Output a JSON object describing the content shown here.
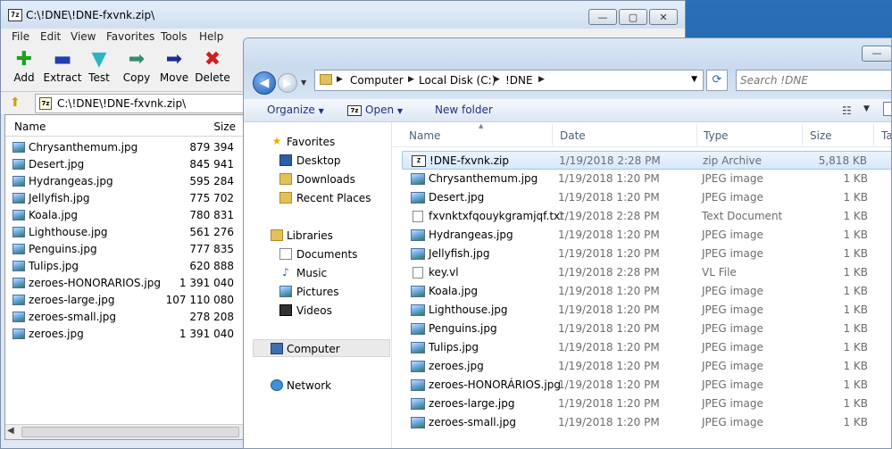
{
  "zip_window": {
    "title": "C:\\!DNE\\!DNE-fxvnk.zip\\",
    "caption": {
      "minimize": "—",
      "maximize": "▢",
      "close": "✕"
    },
    "menu": [
      "File",
      "Edit",
      "View",
      "Favorites",
      "Tools",
      "Help"
    ],
    "toolbar": [
      {
        "label": "Add",
        "icon": "plus-icon",
        "glyph": "✚",
        "color": "#1aa31a"
      },
      {
        "label": "Extract",
        "icon": "minus-icon",
        "glyph": "▬",
        "color": "#1f3fb0"
      },
      {
        "label": "Test",
        "icon": "check-icon",
        "glyph": "▼",
        "color": "#2bb3c4"
      },
      {
        "label": "Copy",
        "icon": "copy-arrow-icon",
        "glyph": "➡",
        "color": "#2f8f6a"
      },
      {
        "label": "Move",
        "icon": "move-arrow-icon",
        "glyph": "➡",
        "color": "#1b2f93"
      },
      {
        "label": "Delete",
        "icon": "delete-x-icon",
        "glyph": "✖",
        "color": "#d11f1f"
      }
    ],
    "path": "C:\\!DNE\\!DNE-fxvnk.zip\\",
    "columns": {
      "name": "Name",
      "size": "Size"
    },
    "files": [
      {
        "name": "Chrysanthemum.jpg",
        "size": "879 394"
      },
      {
        "name": "Desert.jpg",
        "size": "845 941"
      },
      {
        "name": "Hydrangeas.jpg",
        "size": "595 284"
      },
      {
        "name": "Jellyfish.jpg",
        "size": "775 702"
      },
      {
        "name": "Koala.jpg",
        "size": "780 831"
      },
      {
        "name": "Lighthouse.jpg",
        "size": "561 276"
      },
      {
        "name": "Penguins.jpg",
        "size": "777 835"
      },
      {
        "name": "Tulips.jpg",
        "size": "620 888"
      },
      {
        "name": "zeroes-HONORARIOS.jpg",
        "size": "1 391 040"
      },
      {
        "name": "zeroes-large.jpg",
        "size": "107 110 080"
      },
      {
        "name": "zeroes-small.jpg",
        "size": "278 208"
      },
      {
        "name": "zeroes.jpg",
        "size": "1 391 040"
      }
    ]
  },
  "explorer": {
    "breadcrumb": [
      "Computer",
      "Local Disk (C:)",
      "!DNE"
    ],
    "search_placeholder": "Search !DNE",
    "commands": {
      "organize": "Organize",
      "open": "Open",
      "new_folder": "New folder"
    },
    "open_icon_text": "7z",
    "nav": {
      "favorites": "Favorites",
      "favorites_items": [
        "Desktop",
        "Downloads",
        "Recent Places"
      ],
      "libraries": "Libraries",
      "libraries_items": [
        "Documents",
        "Music",
        "Pictures",
        "Videos"
      ],
      "computer": "Computer",
      "network": "Network"
    },
    "columns": {
      "name": "Name",
      "date": "Date",
      "type": "Type",
      "size": "Size",
      "tags": "Ta"
    },
    "files": [
      {
        "name": "!DNE-fxvnk.zip",
        "date": "1/19/2018 2:28 PM",
        "type": "zip Archive",
        "size": "5,818 KB",
        "kind": "zip",
        "selected": true
      },
      {
        "name": "Chrysanthemum.jpg",
        "date": "1/19/2018 1:20 PM",
        "type": "JPEG image",
        "size": "1 KB",
        "kind": "jpg"
      },
      {
        "name": "Desert.jpg",
        "date": "1/19/2018 1:20 PM",
        "type": "JPEG image",
        "size": "1 KB",
        "kind": "jpg"
      },
      {
        "name": "fxvnktxfqouykgramjqf.txt",
        "date": "1/19/2018 2:28 PM",
        "type": "Text Document",
        "size": "1 KB",
        "kind": "txt"
      },
      {
        "name": "Hydrangeas.jpg",
        "date": "1/19/2018 1:20 PM",
        "type": "JPEG image",
        "size": "1 KB",
        "kind": "jpg"
      },
      {
        "name": "Jellyfish.jpg",
        "date": "1/19/2018 1:20 PM",
        "type": "JPEG image",
        "size": "1 KB",
        "kind": "jpg"
      },
      {
        "name": "key.vl",
        "date": "1/19/2018 2:28 PM",
        "type": "VL File",
        "size": "1 KB",
        "kind": "vl"
      },
      {
        "name": "Koala.jpg",
        "date": "1/19/2018 1:20 PM",
        "type": "JPEG image",
        "size": "1 KB",
        "kind": "jpg"
      },
      {
        "name": "Lighthouse.jpg",
        "date": "1/19/2018 1:20 PM",
        "type": "JPEG image",
        "size": "1 KB",
        "kind": "jpg"
      },
      {
        "name": "Penguins.jpg",
        "date": "1/19/2018 1:20 PM",
        "type": "JPEG image",
        "size": "1 KB",
        "kind": "jpg"
      },
      {
        "name": "Tulips.jpg",
        "date": "1/19/2018 1:20 PM",
        "type": "JPEG image",
        "size": "1 KB",
        "kind": "jpg"
      },
      {
        "name": "zeroes.jpg",
        "date": "1/19/2018 1:20 PM",
        "type": "JPEG image",
        "size": "1 KB",
        "kind": "jpg"
      },
      {
        "name": "zeroes-HONORÁRIOS.jpg",
        "date": "1/19/2018 1:20 PM",
        "type": "JPEG image",
        "size": "1 KB",
        "kind": "jpg"
      },
      {
        "name": "zeroes-large.jpg",
        "date": "1/19/2018 1:20 PM",
        "type": "JPEG image",
        "size": "1 KB",
        "kind": "jpg"
      },
      {
        "name": "zeroes-small.jpg",
        "date": "1/19/2018 1:20 PM",
        "type": "JPEG image",
        "size": "1 KB",
        "kind": "jpg"
      }
    ]
  }
}
